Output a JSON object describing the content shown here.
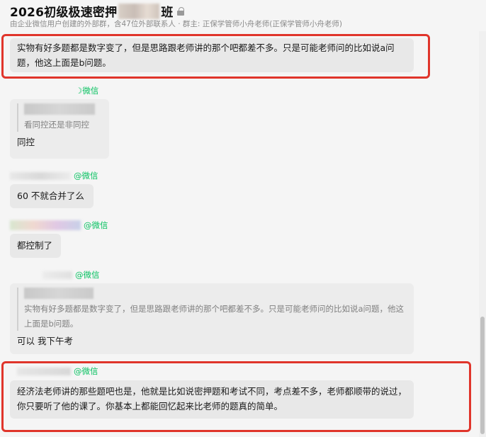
{
  "header": {
    "title_prefix": "2026初级极速密押",
    "title_suffix": "班",
    "subtitle": "由企业微信用户创建的外部群，含47位外部联系人 · 群主: 正保学管师小舟老师(正保学管师小舟老师)"
  },
  "messages": [
    {
      "text": "实物有好多题都是数字变了，但是思路跟老师讲的那个吧都差不多。只是可能老师问的比如说a问题，他这上面是b问题。"
    },
    {
      "sender_suffix": "微信",
      "quote": "看同控还是非同控",
      "text": "同控"
    },
    {
      "sender_suffix": "微信",
      "text": "60 不就合并了么"
    },
    {
      "sender_suffix": "微信",
      "text": "都控制了"
    },
    {
      "sender_suffix": "微信",
      "quote": "实物有好多题都是数字变了，但是思路跟老师讲的那个吧都差不多。只是可能老师问的比如说a问题，他这上面是b问题。",
      "text": "可以 我下午考"
    },
    {
      "sender_suffix": "微信",
      "text": "经济法老师讲的那些题吧也是，他就是比如说密押题和考试不同，考点差不多，老师都顺带的说过，你只要听了他的课了。你基本上都能回忆起来比老师的题真的简单。"
    }
  ],
  "colors": {
    "highlight": "#e0352b",
    "wechat_green": "#07c160",
    "bubble": "#e8e8e8"
  }
}
